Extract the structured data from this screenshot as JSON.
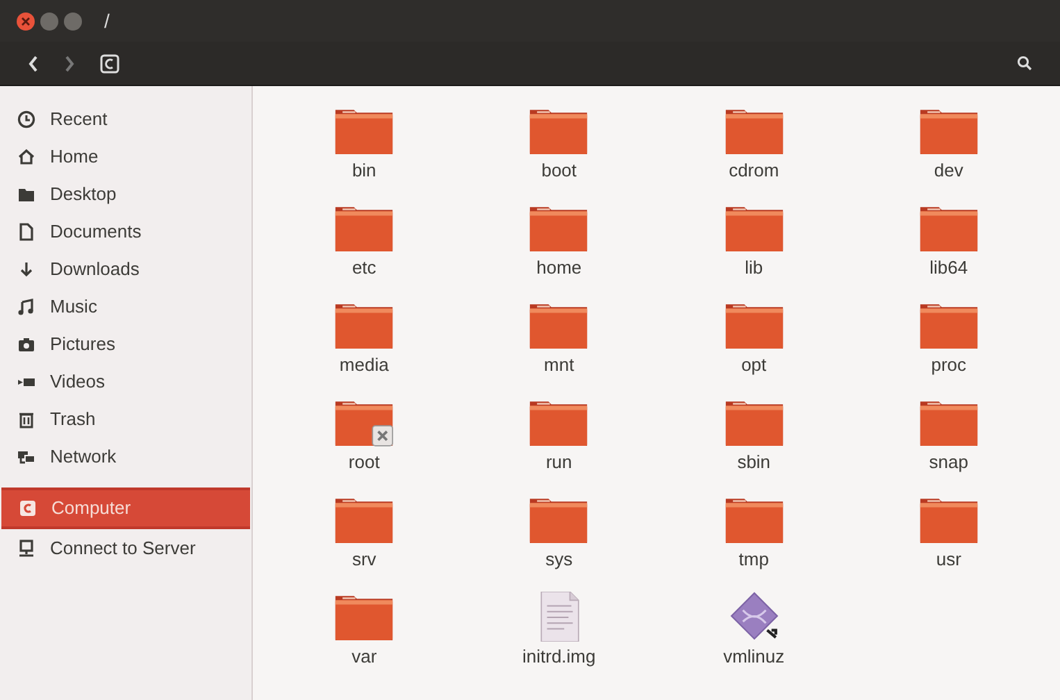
{
  "window": {
    "title": "/"
  },
  "sidebar": {
    "items": [
      {
        "label": "Recent",
        "kind": "recent",
        "selected": false
      },
      {
        "label": "Home",
        "kind": "home",
        "selected": false
      },
      {
        "label": "Desktop",
        "kind": "desktop",
        "selected": false
      },
      {
        "label": "Documents",
        "kind": "documents",
        "selected": false
      },
      {
        "label": "Downloads",
        "kind": "downloads",
        "selected": false
      },
      {
        "label": "Music",
        "kind": "music",
        "selected": false
      },
      {
        "label": "Pictures",
        "kind": "pictures",
        "selected": false
      },
      {
        "label": "Videos",
        "kind": "videos",
        "selected": false
      },
      {
        "label": "Trash",
        "kind": "trash",
        "selected": false
      },
      {
        "label": "Network",
        "kind": "network",
        "selected": false
      },
      {
        "label": "Computer",
        "kind": "computer",
        "selected": true
      },
      {
        "label": "Connect to Server",
        "kind": "server",
        "selected": false
      }
    ]
  },
  "files": [
    {
      "name": "bin",
      "kind": "folder"
    },
    {
      "name": "boot",
      "kind": "folder"
    },
    {
      "name": "cdrom",
      "kind": "folder"
    },
    {
      "name": "dev",
      "kind": "folder"
    },
    {
      "name": "etc",
      "kind": "folder"
    },
    {
      "name": "home",
      "kind": "folder"
    },
    {
      "name": "lib",
      "kind": "folder"
    },
    {
      "name": "lib64",
      "kind": "folder"
    },
    {
      "name": "media",
      "kind": "folder"
    },
    {
      "name": "mnt",
      "kind": "folder"
    },
    {
      "name": "opt",
      "kind": "folder"
    },
    {
      "name": "proc",
      "kind": "folder"
    },
    {
      "name": "root",
      "kind": "folder-locked"
    },
    {
      "name": "run",
      "kind": "folder"
    },
    {
      "name": "sbin",
      "kind": "folder"
    },
    {
      "name": "snap",
      "kind": "folder"
    },
    {
      "name": "srv",
      "kind": "folder"
    },
    {
      "name": "sys",
      "kind": "folder"
    },
    {
      "name": "tmp",
      "kind": "folder"
    },
    {
      "name": "usr",
      "kind": "folder"
    },
    {
      "name": "var",
      "kind": "folder"
    },
    {
      "name": "initrd.img",
      "kind": "document"
    },
    {
      "name": "vmlinuz",
      "kind": "link"
    }
  ]
}
